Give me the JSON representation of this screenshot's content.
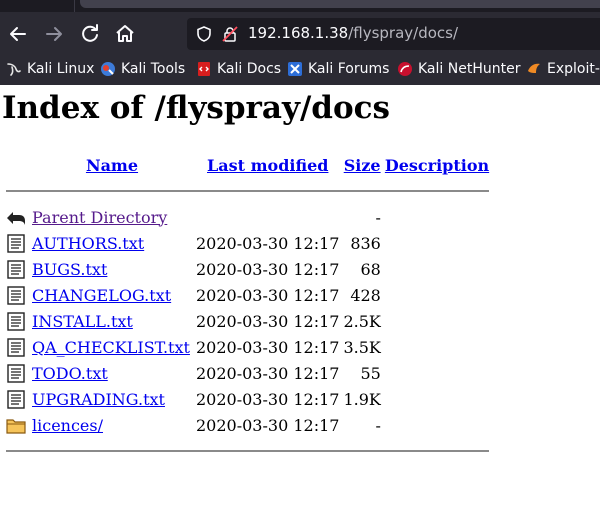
{
  "browser": {
    "url_host": "192.168.1.38",
    "url_path": "/flyspray/docs/",
    "bookmarks": [
      {
        "label": "Kali Linux",
        "icon": "kali-dragon-icon"
      },
      {
        "label": "Kali Tools",
        "icon": "kali-tools-icon"
      },
      {
        "label": "Kali Docs",
        "icon": "kali-docs-icon"
      },
      {
        "label": "Kali Forums",
        "icon": "kali-forums-icon"
      },
      {
        "label": "Kali NetHunter",
        "icon": "kali-nethunter-icon"
      },
      {
        "label": "Exploit-D",
        "icon": "exploit-db-icon"
      }
    ]
  },
  "page": {
    "title": "Index of /flyspray/docs",
    "columns": {
      "name": "Name",
      "last_modified": "Last modified",
      "size": "Size",
      "description": "Description"
    },
    "rows": [
      {
        "name": "Parent Directory",
        "modified": "",
        "size": "-",
        "icon": "back-arrow-icon"
      },
      {
        "name": "AUTHORS.txt",
        "modified": "2020-03-30 12:17",
        "size": "836",
        "icon": "text-file-icon"
      },
      {
        "name": "BUGS.txt",
        "modified": "2020-03-30 12:17",
        "size": "68",
        "icon": "text-file-icon"
      },
      {
        "name": "CHANGELOG.txt",
        "modified": "2020-03-30 12:17",
        "size": "428",
        "icon": "text-file-icon"
      },
      {
        "name": "INSTALL.txt",
        "modified": "2020-03-30 12:17",
        "size": "2.5K",
        "icon": "text-file-icon"
      },
      {
        "name": "QA_CHECKLIST.txt",
        "modified": "2020-03-30 12:17",
        "size": "3.5K",
        "icon": "text-file-icon"
      },
      {
        "name": "TODO.txt",
        "modified": "2020-03-30 12:17",
        "size": "55",
        "icon": "text-file-icon"
      },
      {
        "name": "UPGRADING.txt",
        "modified": "2020-03-30 12:17",
        "size": "1.9K",
        "icon": "text-file-icon"
      },
      {
        "name": "licences/",
        "modified": "2020-03-30 12:17",
        "size": "-",
        "icon": "folder-icon"
      }
    ]
  }
}
